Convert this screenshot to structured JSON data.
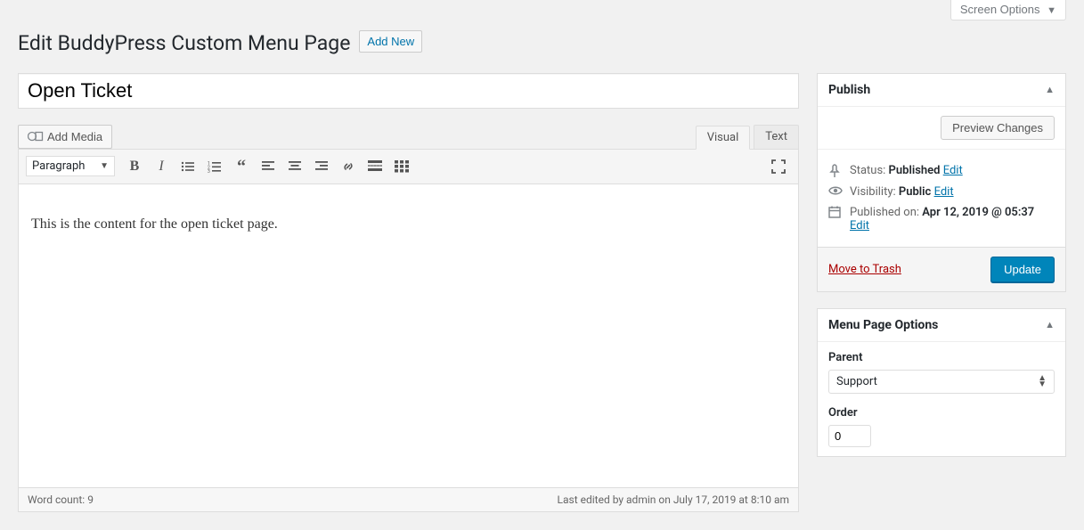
{
  "top": {
    "screen_options": "Screen Options"
  },
  "header": {
    "title": "Edit BuddyPress Custom Menu Page",
    "add_new": "Add New"
  },
  "post": {
    "title": "Open Ticket",
    "content": "This is the content for the open ticket page."
  },
  "media": {
    "add_media": "Add Media"
  },
  "tabs": {
    "visual": "Visual",
    "text": "Text"
  },
  "toolbar": {
    "format_label": "Paragraph"
  },
  "status": {
    "word_count_label": "Word count: ",
    "word_count": "9",
    "last_edited": "Last edited by admin on July 17, 2019 at 8:10 am"
  },
  "publish": {
    "box_title": "Publish",
    "preview": "Preview Changes",
    "status_label": "Status: ",
    "status_value": "Published",
    "visibility_label": "Visibility: ",
    "visibility_value": "Public",
    "published_label": "Published on: ",
    "published_value": "Apr 12, 2019 @ 05:37",
    "edit": "Edit",
    "trash": "Move to Trash",
    "update": "Update"
  },
  "options": {
    "box_title": "Menu Page Options",
    "parent_label": "Parent",
    "parent_value": "Support",
    "order_label": "Order",
    "order_value": "0"
  }
}
